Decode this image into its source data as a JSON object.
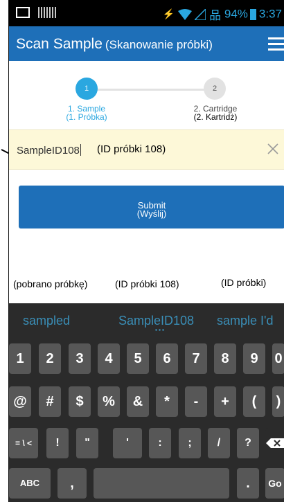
{
  "status_bar": {
    "battery": "94%",
    "time": "3:37"
  },
  "app_bar": {
    "title": "Scan Sample",
    "title_translation": "(Skanowanie próbki)"
  },
  "stepper": {
    "step1": {
      "number": "1",
      "label": "1. Sample",
      "label_translation": "(1. Próbka)"
    },
    "step2": {
      "number": "2",
      "label": "2. Cartridge",
      "label_translation": "(2. Kartridż)"
    }
  },
  "input": {
    "value": "SampleID108",
    "translation": "(ID próbki 108)"
  },
  "submit": {
    "label": "Submit",
    "label_translation": "(Wyślij)"
  },
  "translations": [
    "(pobrano próbkę)",
    "(ID próbki 108)",
    "(ID próbki)"
  ],
  "keyboard": {
    "suggestions": [
      "sampled",
      "SampleID108",
      "sample I'd"
    ],
    "row1": [
      "1",
      "2",
      "3",
      "4",
      "5",
      "6",
      "7",
      "8",
      "9",
      "0"
    ],
    "row2": [
      "@",
      "#",
      "$",
      "%",
      "&",
      "*",
      "-",
      "+",
      "(",
      ")"
    ],
    "row3": [
      "= \\ <",
      "!",
      "\"",
      "'",
      ":",
      ";",
      "/",
      "?"
    ],
    "row4": {
      "abc": "ABC",
      "comma": ",",
      "period": ".",
      "go": "Go"
    }
  },
  "colors": {
    "primary": "#1e6fb8",
    "accent": "#2aa7e0",
    "input_bg": "#fdf8d8",
    "keyboard_bg": "#2b2b2b",
    "key_bg": "#575757"
  }
}
